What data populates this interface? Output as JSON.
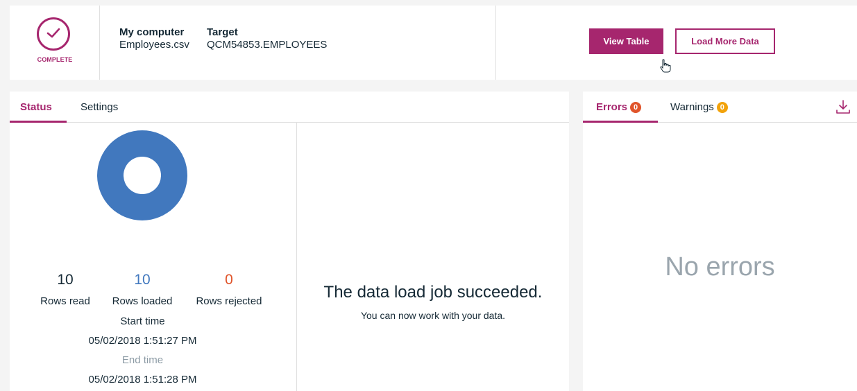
{
  "header": {
    "status_label": "COMPLETE",
    "source_heading": "My computer",
    "source_value": "Employees.csv",
    "target_heading": "Target",
    "target_value": "QCM54853.EMPLOYEES",
    "view_table_label": "View Table",
    "load_more_label": "Load More Data"
  },
  "status_panel": {
    "tabs": [
      {
        "label": "Status",
        "active": true
      },
      {
        "label": "Settings",
        "active": false
      }
    ],
    "stats": [
      {
        "value": "10",
        "label": "Rows read",
        "color": "#152935"
      },
      {
        "value": "10",
        "label": "Rows loaded",
        "color": "#4178be"
      },
      {
        "value": "0",
        "label": "Rows rejected",
        "color": "#e0542a"
      }
    ],
    "start_time_label": "Start time",
    "start_time": "05/02/2018 1:51:27 PM",
    "end_time_label": "End time",
    "end_time": "05/02/2018 1:51:28 PM",
    "message_title": "The data load job succeeded.",
    "message_sub": "You can now work with your data."
  },
  "chart_data": {
    "type": "pie",
    "categories": [
      "Rows loaded",
      "Rows rejected"
    ],
    "values": [
      10,
      0
    ]
  },
  "errors_panel": {
    "tabs": [
      {
        "label": "Errors",
        "count": "0",
        "badge_color": "#e0542a",
        "active": true
      },
      {
        "label": "Warnings",
        "count": "0",
        "badge_color": "#f2a20a",
        "active": false
      }
    ],
    "empty_message": "No errors",
    "download_icon": "download-icon"
  },
  "colors": {
    "accent": "#a6266e",
    "loaded_blue": "#4178be"
  }
}
